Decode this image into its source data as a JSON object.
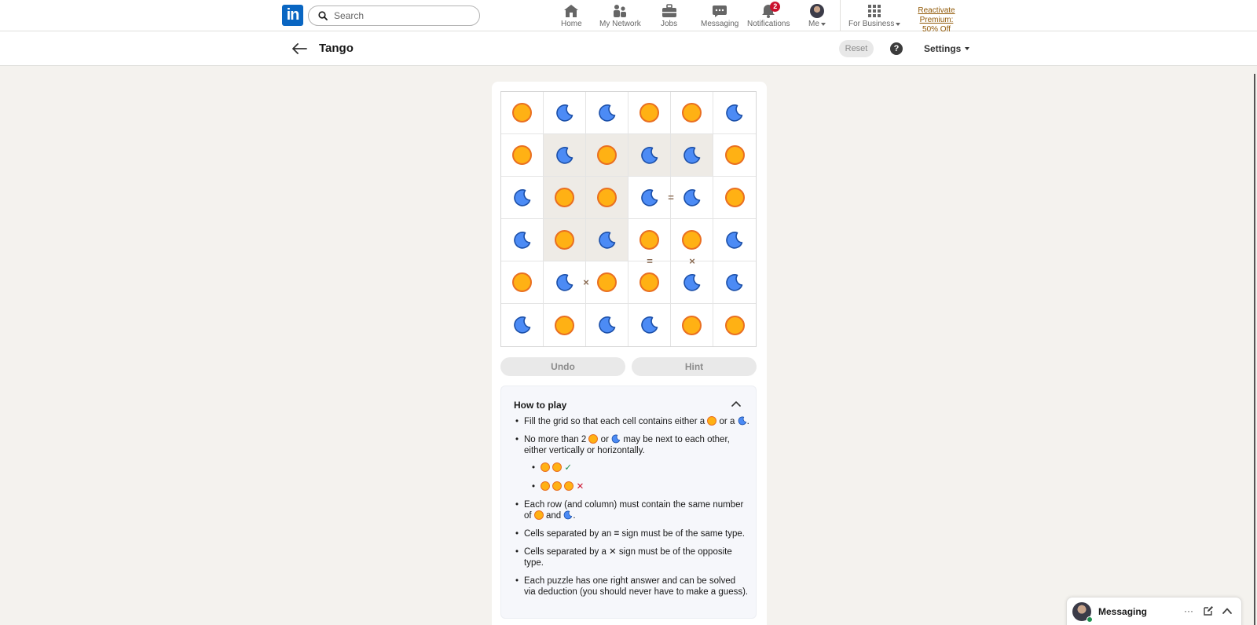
{
  "nav": {
    "logo": "in",
    "search_placeholder": "Search",
    "items": [
      {
        "label": "Home",
        "icon": "home-icon"
      },
      {
        "label": "My Network",
        "icon": "network-icon"
      },
      {
        "label": "Jobs",
        "icon": "briefcase-icon"
      },
      {
        "label": "Messaging",
        "icon": "chat-icon"
      },
      {
        "label": "Notifications",
        "icon": "bell-icon",
        "badge": "2"
      },
      {
        "label": "Me",
        "icon": "avatar"
      }
    ],
    "business_label": "For Business",
    "premium_line1": "Reactivate Premium:",
    "premium_line2": "50% Off"
  },
  "header": {
    "title": "Tango",
    "reset_label": "Reset",
    "help_label": "?",
    "settings_label": "Settings"
  },
  "grid": {
    "size": 6,
    "cells": [
      [
        "sun",
        "moon",
        "moon",
        "sun",
        "sun",
        "moon"
      ],
      [
        "sun",
        "moon",
        "sun",
        "moon",
        "moon",
        "sun"
      ],
      [
        "moon",
        "sun",
        "sun",
        "moon",
        "moon",
        "sun"
      ],
      [
        "moon",
        "sun",
        "moon",
        "sun",
        "sun",
        "moon"
      ],
      [
        "sun",
        "moon",
        "sun",
        "sun",
        "moon",
        "moon"
      ],
      [
        "moon",
        "sun",
        "moon",
        "moon",
        "sun",
        "sun"
      ]
    ],
    "locked": [
      [
        1,
        1
      ],
      [
        1,
        2
      ],
      [
        1,
        3
      ],
      [
        1,
        4
      ],
      [
        2,
        1
      ],
      [
        2,
        2
      ],
      [
        3,
        1
      ],
      [
        3,
        2
      ]
    ],
    "signs": [
      {
        "between": [
          [
            2,
            3
          ],
          [
            2,
            4
          ]
        ],
        "type": "="
      },
      {
        "between": [
          [
            3,
            3
          ],
          [
            4,
            3
          ]
        ],
        "type": "="
      },
      {
        "between": [
          [
            3,
            4
          ],
          [
            4,
            4
          ]
        ],
        "type": "×"
      },
      {
        "between": [
          [
            4,
            1
          ],
          [
            4,
            2
          ]
        ],
        "type": "×"
      }
    ],
    "colors": {
      "sun_fill": "#ffb114",
      "sun_stroke": "#e96f21",
      "moon_fill": "#4c8bf5",
      "moon_stroke": "#1b4fa8",
      "locked_bg": "#eeebe6"
    }
  },
  "controls": {
    "undo_label": "Undo",
    "hint_label": "Hint"
  },
  "howto": {
    "heading": "How to play",
    "r1_a": "Fill the grid so that each cell contains either a",
    "r1_b": "or a",
    "r1_c": ".",
    "r2_a": "No more than 2",
    "r2_b": "or",
    "r2_c": "may be next to each other, either vertically or horizontally.",
    "ok_mark": "✓",
    "no_mark": "✕",
    "r3_a": "Each row (and column) must contain the same number of",
    "r3_b": "and",
    "r3_c": ".",
    "r4_a": "Cells separated by an",
    "r4_sign": "=",
    "r4_b": "sign must be of the same type.",
    "r5_a": "Cells separated by a",
    "r5_sign": "✕",
    "r5_b": "sign must be of the opposite type.",
    "r6": "Each puzzle has one right answer and can be solved via deduction (you should never have to make a guess)."
  },
  "messaging": {
    "title": "Messaging",
    "more": "···"
  }
}
